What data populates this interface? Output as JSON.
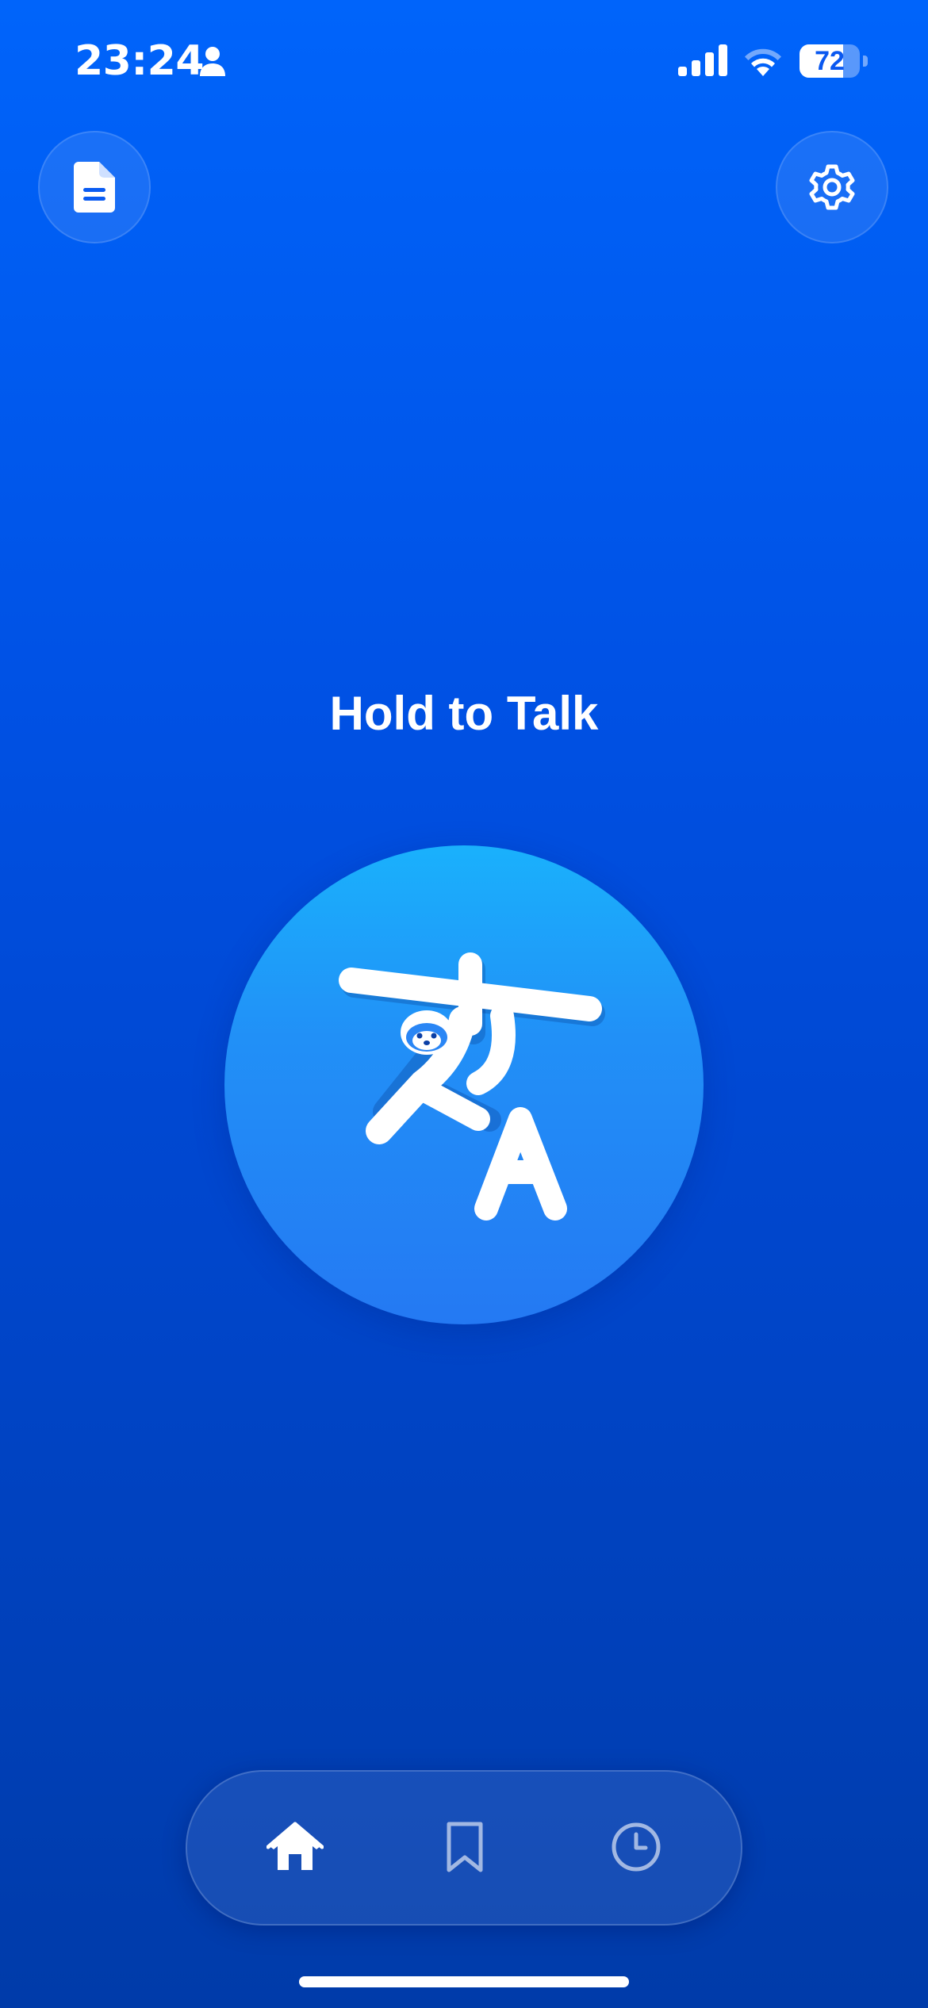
{
  "status_bar": {
    "time": "23:24",
    "battery_text": "72",
    "battery_level_percent": 72
  },
  "header": {
    "left_button_icon": "document-icon",
    "right_button_icon": "gear-icon"
  },
  "main": {
    "prompt": "Hold to Talk",
    "talk_button_icon": "sloth-translate-logo"
  },
  "tab_bar": {
    "tabs": [
      {
        "icon": "home-icon",
        "active": true
      },
      {
        "icon": "bookmark-icon",
        "active": false
      },
      {
        "icon": "clock-icon",
        "active": false
      }
    ]
  },
  "colors": {
    "background_top": "#0064fb",
    "background_bottom": "#003ba9",
    "talk_button_top": "#1ab1fc",
    "talk_button_bottom": "#2479f3",
    "accent_white": "#ffffff"
  }
}
